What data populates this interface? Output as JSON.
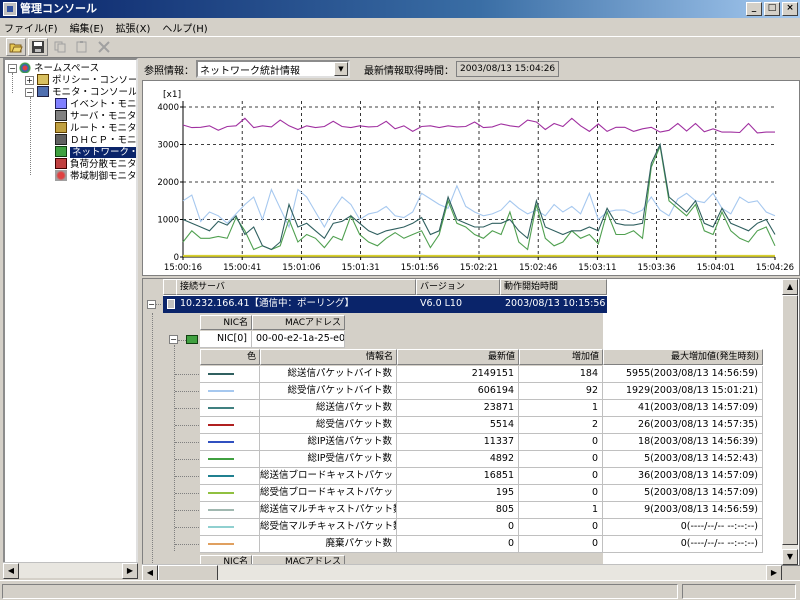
{
  "window": {
    "title": "管理コンソール"
  },
  "menu": [
    "ファイル(F)",
    "編集(E)",
    "拡張(X)",
    "ヘルプ(H)"
  ],
  "toolbar": [
    {
      "name": "open-folder-icon",
      "enabled": true
    },
    {
      "name": "save-icon",
      "enabled": true
    },
    {
      "name": "copy-icon",
      "enabled": false
    },
    {
      "name": "paste-icon",
      "enabled": false
    },
    {
      "name": "delete-icon",
      "enabled": false
    }
  ],
  "tree": {
    "root": "ネームスペース",
    "policy": "ポリシー・コンソール",
    "monitor": "モニタ・コンソール",
    "items": [
      "イベント・モニタ",
      "サーバ・モニタ",
      "ルート・モニタ",
      "ＤＨＣＰ・モニタ",
      "ネットワーク・モ",
      "負荷分散モニタ",
      "帯域制御モニタ"
    ],
    "selected_index": 4
  },
  "refbar": {
    "label": "参照情報：",
    "selected": "ネットワーク統計情報",
    "last_label": "最新情報取得時間：",
    "last_value": "2003/08/13 15:04:26"
  },
  "chart_data": {
    "type": "line",
    "ylabel": "[x1]",
    "ylim": [
      0,
      4000
    ],
    "yticks": [
      "0",
      "1000",
      "2000",
      "3000",
      "4000"
    ],
    "xticks": [
      "15:00:16",
      "15:00:41",
      "15:01:06",
      "15:01:31",
      "15:01:56",
      "15:02:21",
      "15:02:46",
      "15:03:11",
      "15:03:36",
      "15:04:01",
      "15:04:26"
    ],
    "grid": true,
    "series": [
      {
        "color": "#a030a0",
        "values": [
          3520,
          3450,
          3460,
          3500,
          3380,
          3480,
          3500,
          3700,
          3450,
          3500,
          3470,
          3650,
          3500,
          3400,
          3500,
          3450,
          3480,
          3620,
          3480,
          3450,
          3500,
          3470,
          3480,
          3620,
          3420,
          3500,
          3350,
          3480,
          3500,
          3450,
          3500,
          3470,
          3480,
          3600,
          3450,
          3470,
          3550,
          3500,
          3470,
          3650,
          3600,
          3400,
          3560,
          3480,
          3700,
          3500,
          3350,
          3550,
          3350,
          3460,
          3460,
          3350,
          3420,
          3460,
          3330,
          3380,
          3560,
          3360,
          3560,
          3340,
          3420,
          3330,
          3330,
          3320,
          3560,
          3310,
          3330,
          3330
        ]
      },
      {
        "color": "#a6c8ef",
        "values": [
          1500,
          1650,
          950,
          1200,
          1100,
          900,
          1150,
          1400,
          1600,
          1000,
          1800,
          1300,
          800,
          1800,
          1600,
          1200,
          800,
          1250,
          1600,
          1400,
          1000,
          1150,
          1200,
          1350,
          1100,
          1050,
          1200,
          1700,
          1550,
          1400,
          1300,
          1900,
          1350,
          1200,
          1100,
          1150,
          1250,
          1500,
          1300,
          1150,
          1250,
          1100,
          1400,
          1200,
          1350,
          1150,
          1700,
          1000,
          1200,
          1250,
          1250,
          1150,
          1250,
          1600,
          1250,
          1100,
          1550,
          1700,
          1500,
          1450,
          1700,
          1300,
          1150,
          1600,
          1450,
          1500,
          1200,
          1100
        ]
      },
      {
        "color": "#50a050",
        "values": [
          400,
          700,
          500,
          500,
          550,
          500,
          1050,
          700,
          200,
          300,
          200,
          300,
          1000,
          400,
          600,
          500,
          250,
          550,
          450,
          1100,
          600,
          400,
          300,
          500,
          650,
          500,
          600,
          700,
          250,
          600,
          1500,
          900,
          800,
          600,
          500,
          700,
          600,
          1200,
          400,
          200,
          1400,
          500,
          300,
          400,
          700,
          500,
          600,
          350,
          1200,
          600,
          600,
          700,
          500,
          2400,
          2950,
          1500,
          1300,
          1100,
          1400,
          700,
          600,
          1200,
          700,
          500,
          400,
          700,
          800,
          300
        ]
      },
      {
        "color": "#306060",
        "values": [
          1000,
          900,
          800,
          700,
          950,
          850,
          1100,
          600,
          800,
          300,
          200,
          400,
          1400,
          800,
          900,
          700,
          500,
          900,
          950,
          1100,
          900,
          700,
          600,
          700,
          750,
          800,
          900,
          1050,
          600,
          700,
          1600,
          1000,
          900,
          800,
          800,
          900,
          900,
          1000,
          700,
          500,
          1500,
          800,
          700,
          600,
          700,
          700,
          800,
          700,
          1300,
          900,
          850,
          850,
          900,
          2500,
          3000,
          1600,
          1400,
          1200,
          1500,
          900,
          800,
          1300,
          900,
          800,
          700,
          900,
          1000,
          600
        ]
      },
      {
        "color": "#d8d030",
        "values": [
          30,
          30,
          30,
          30,
          30,
          30,
          30,
          30,
          30,
          30,
          30,
          30,
          30,
          30,
          30,
          30,
          30,
          30,
          30,
          30,
          30,
          30,
          30,
          30,
          30,
          30,
          30,
          30,
          30,
          30,
          30,
          30,
          30,
          30,
          30,
          30,
          30,
          30,
          30,
          30,
          30,
          30,
          30,
          30,
          30,
          30,
          30,
          30,
          30,
          30,
          30,
          30,
          30,
          30,
          30,
          30,
          30,
          30,
          30,
          30,
          30,
          30,
          30,
          30,
          30,
          30,
          30,
          30
        ]
      }
    ]
  },
  "server": {
    "headers": [
      "接続サーバ",
      "バージョン",
      "動作開始時間"
    ],
    "name": "10.232.166.41【通信中：ポーリング】",
    "version": "V6.0 L10",
    "start": "2003/08/13 10:15:56"
  },
  "nic": {
    "headers": [
      "NIC名",
      "MACアドレス"
    ],
    "name": "NIC[0]",
    "mac": "00-00-e2-1a-25-e0"
  },
  "stats": {
    "headers": [
      "色",
      "情報名",
      "最新値",
      "増加値",
      "最大増加値(発生時刻)"
    ],
    "rows": [
      {
        "color": "#306060",
        "name": "総送信パケットバイト数",
        "latest": "2149151",
        "inc": "184",
        "max": "5955(2003/08/13 14:56:59)"
      },
      {
        "color": "#a6c8ef",
        "name": "総受信パケットバイト数",
        "latest": "606194",
        "inc": "92",
        "max": "1929(2003/08/13 15:01:21)"
      },
      {
        "color": "#408080",
        "name": "総送信パケット数",
        "latest": "23871",
        "inc": "1",
        "max": "41(2003/08/13 14:57:09)"
      },
      {
        "color": "#b02020",
        "name": "総受信パケット数",
        "latest": "5514",
        "inc": "2",
        "max": "26(2003/08/13 14:57:35)"
      },
      {
        "color": "#3050c0",
        "name": "総IP送信パケット数",
        "latest": "11337",
        "inc": "0",
        "max": "18(2003/08/13 14:56:39)"
      },
      {
        "color": "#40a040",
        "name": "総IP受信パケット数",
        "latest": "4892",
        "inc": "0",
        "max": "5(2003/08/13 14:52:43)"
      },
      {
        "color": "#208090",
        "name": "総送信ブロードキャストパケット数",
        "latest": "16851",
        "inc": "0",
        "max": "36(2003/08/13 14:57:09)"
      },
      {
        "color": "#90c040",
        "name": "総受信ブロードキャストパケット数",
        "latest": "195",
        "inc": "0",
        "max": "5(2003/08/13 14:57:09)"
      },
      {
        "color": "#a0b8b0",
        "name": "総送信マルチキャストパケット数",
        "latest": "805",
        "inc": "1",
        "max": "9(2003/08/13 14:56:59)"
      },
      {
        "color": "#90d0d0",
        "name": "総受信マルチキャストパケット数",
        "latest": "0",
        "inc": "0",
        "max": "0(----/--/-- --:--:--)"
      },
      {
        "color": "#e0a060",
        "name": "廃棄パケット数",
        "latest": "0",
        "inc": "0",
        "max": "0(----/--/-- --:--:--)"
      }
    ]
  },
  "nic2": {
    "headers": [
      "NIC名",
      "MACアドレス"
    ]
  }
}
